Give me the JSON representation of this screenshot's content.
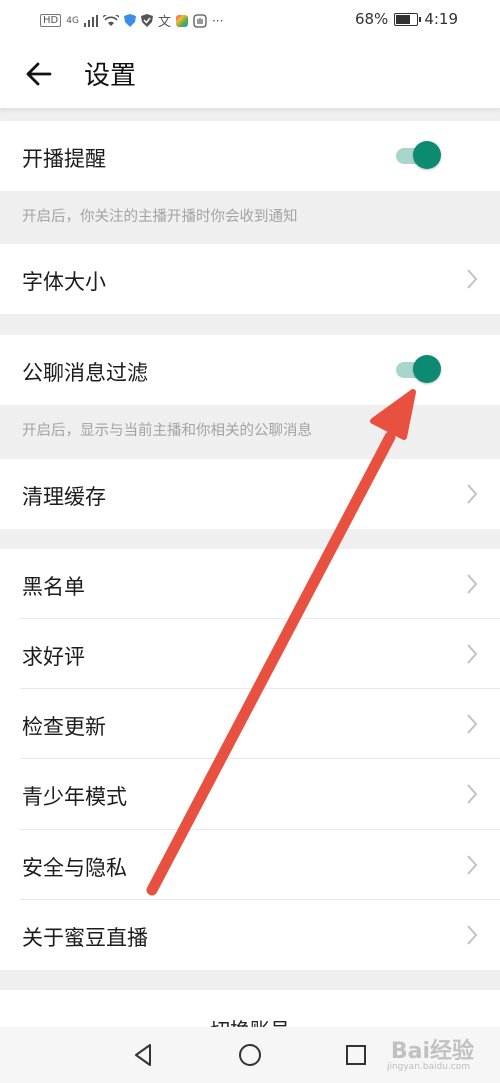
{
  "status_bar": {
    "left_indicators": [
      "HD",
      "4G"
    ],
    "battery": "68%",
    "battery_level": 0.68,
    "time": "4:19"
  },
  "header": {
    "back_icon": "arrow-left-icon",
    "title": "设置"
  },
  "settings": {
    "live_reminder": {
      "label": "开播提醒",
      "enabled": true,
      "hint": "开启后，你关注的主播开播时你会收到通知"
    },
    "font_size": {
      "label": "字体大小"
    },
    "public_chat_filter": {
      "label": "公聊消息过滤",
      "enabled": true,
      "hint": "开启后，显示与当前主播和你相关的公聊消息"
    },
    "clear_cache": {
      "label": "清理缓存"
    },
    "blacklist": {
      "label": "黑名单"
    },
    "rate_us": {
      "label": "求好评"
    },
    "check_update": {
      "label": "检查更新"
    },
    "teen_mode": {
      "label": "青少年模式"
    },
    "security_privacy": {
      "label": "安全与隐私"
    },
    "about": {
      "label": "关于蜜豆直播"
    },
    "switch_account": {
      "label": "切换账号"
    }
  },
  "colors": {
    "toggle_on_knob": "#0c8a72",
    "toggle_on_track": "#a9d6cc",
    "annotation_arrow": "#e8503f"
  },
  "watermark": {
    "text": "Bai经验",
    "sub": "jingyan.baidu.com"
  },
  "nav": {
    "back_icon": "triangle-back-icon",
    "home_icon": "circle-home-icon",
    "recents_icon": "square-recents-icon"
  }
}
